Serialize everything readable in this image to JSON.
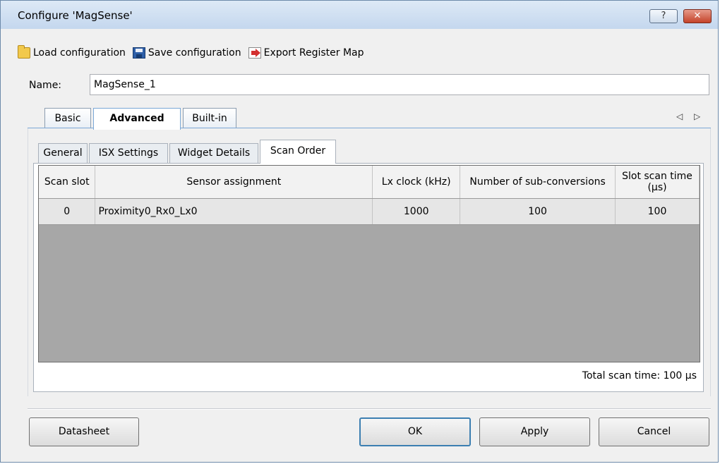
{
  "window": {
    "title": "Configure 'MagSense'",
    "help_label": "?",
    "close_label": "✕"
  },
  "toolbar": {
    "load_label": "Load configuration",
    "save_label": "Save configuration",
    "export_label": "Export Register Map",
    "icons": [
      "folder-icon",
      "save-icon",
      "export-icon"
    ]
  },
  "name": {
    "label": "Name:",
    "value": "MagSense_1"
  },
  "outer_tabs": [
    {
      "label": "Basic"
    },
    {
      "label": "Advanced"
    },
    {
      "label": "Built-in"
    }
  ],
  "outer_tab_arrows": "◁ ▷",
  "inner_tabs": [
    {
      "label": "General"
    },
    {
      "label": "ISX Settings"
    },
    {
      "label": "Widget Details"
    },
    {
      "label": "Scan Order"
    }
  ],
  "grid": {
    "headers": [
      "Scan slot",
      "Sensor assignment",
      "Lx clock (kHz)",
      "Number of sub-conversions",
      "Slot scan time (µs)"
    ],
    "rows": [
      [
        "0",
        "Proximity0_Rx0_Lx0",
        "1000",
        "100",
        "100"
      ]
    ]
  },
  "total_scan_time": "Total scan time:  100 µs",
  "buttons": {
    "datasheet": "Datasheet",
    "ok": "OK",
    "apply": "Apply",
    "cancel": "Cancel"
  }
}
